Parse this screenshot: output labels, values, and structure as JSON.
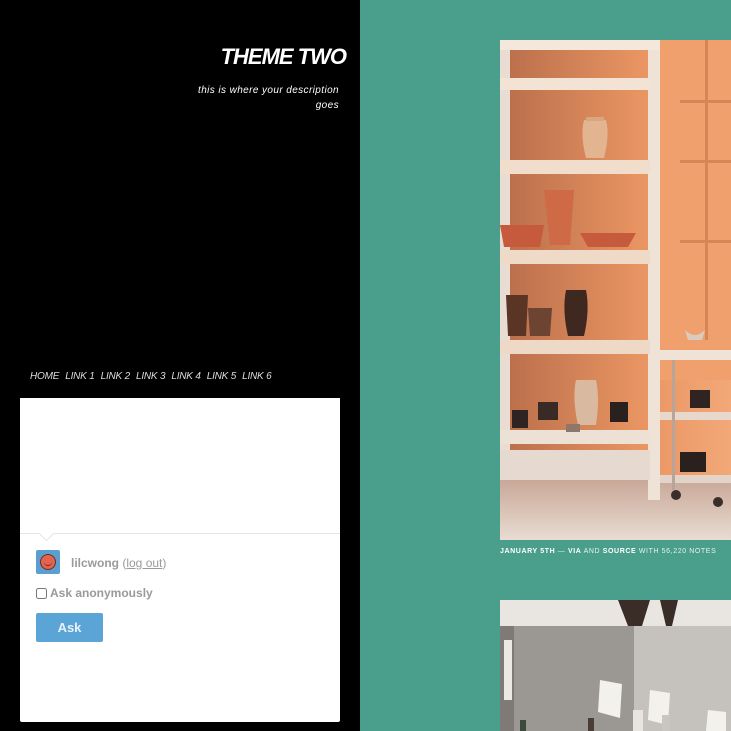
{
  "sidebar": {
    "title": "THEME TWO",
    "description": "this is where your description goes",
    "nav": [
      "HOME",
      "LINK 1",
      "LINK 2",
      "LINK 3",
      "LINK 4",
      "LINK 5",
      "LINK 6"
    ]
  },
  "ask": {
    "username": "lilcwong",
    "logout_label": "log out",
    "anon_label": "Ask anonymously",
    "button_label": "Ask"
  },
  "posts": [
    {
      "date": "JANUARY 5TH",
      "sep": "—",
      "via": "VIA",
      "and": "AND",
      "source": "SOURCE",
      "notes": "WITH 56,220 NOTES"
    }
  ],
  "colors": {
    "background": "#4a9e8c",
    "sidebar": "#000000",
    "ask_button": "#5aa5d6"
  }
}
